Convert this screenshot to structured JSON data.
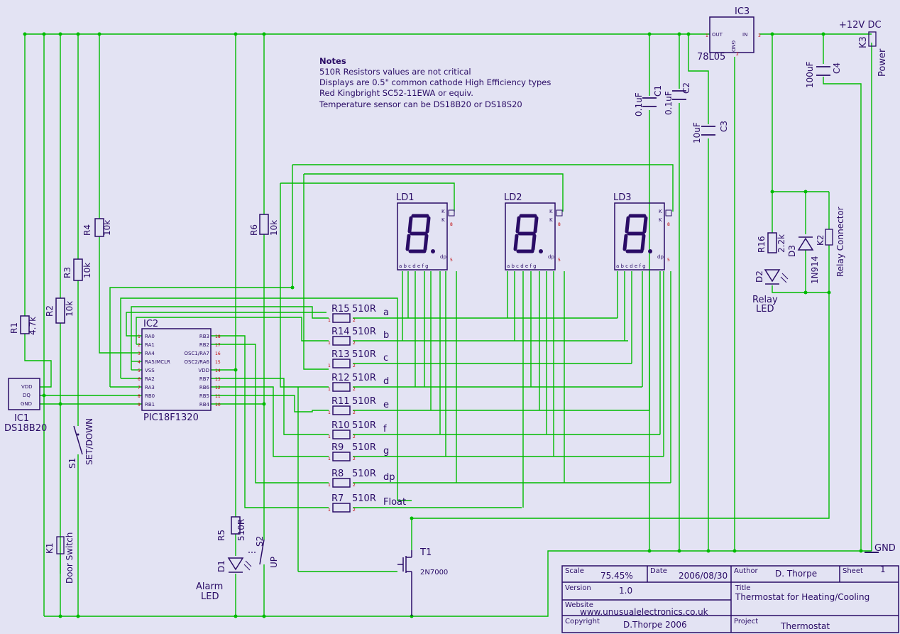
{
  "notes": {
    "heading": "Notes",
    "lines": [
      "510R Resistors values are not critical",
      "Displays are 0.5\" common cathode High Efficiency types",
      "Red Kingbright SC52-11EWA or equiv.",
      "Temperature sensor can be  DS18B20 or DS18S20"
    ]
  },
  "power": {
    "supply_label": "+12V DC",
    "gnd_label": "GND",
    "connector_ref": "K3",
    "connector_name": "Power"
  },
  "regulator": {
    "ref": "IC3",
    "part": "78L05",
    "pin_out": "OUT",
    "pin_in": "IN",
    "pin_gnd": "GND"
  },
  "capacitors": [
    {
      "ref": "C1",
      "value": "0.1uF"
    },
    {
      "ref": "C2",
      "value": "0.1uF"
    },
    {
      "ref": "C3",
      "value": "10uF"
    },
    {
      "ref": "C4",
      "value": "100uF"
    }
  ],
  "pull_resistors": [
    {
      "ref": "R1",
      "value": "4.7k"
    },
    {
      "ref": "R2",
      "value": "10k"
    },
    {
      "ref": "R3",
      "value": "10k"
    },
    {
      "ref": "R4",
      "value": "10k"
    },
    {
      "ref": "R6",
      "value": "10k"
    },
    {
      "ref": "R5",
      "value": "510R"
    },
    {
      "ref": "R16",
      "value": "2.2k"
    }
  ],
  "segment_resistors": [
    {
      "ref": "R15",
      "value": "510R",
      "net": "a"
    },
    {
      "ref": "R14",
      "value": "510R",
      "net": "b"
    },
    {
      "ref": "R13",
      "value": "510R",
      "net": "c"
    },
    {
      "ref": "R12",
      "value": "510R",
      "net": "d"
    },
    {
      "ref": "R11",
      "value": "510R",
      "net": "e"
    },
    {
      "ref": "R10",
      "value": "510R",
      "net": "f"
    },
    {
      "ref": "R9",
      "value": "510R",
      "net": "g"
    },
    {
      "ref": "R8",
      "value": "510R",
      "net": "dp"
    },
    {
      "ref": "R7",
      "value": "510R",
      "net": "Float"
    }
  ],
  "displays": [
    {
      "ref": "LD1",
      "seg_row": "a b c d e f g"
    },
    {
      "ref": "LD2",
      "seg_row": "a b c d e f g"
    },
    {
      "ref": "LD3",
      "seg_row": "a b c d e f g"
    }
  ],
  "display_pins": {
    "k": "K",
    "dp": "dp",
    "glyph": "8"
  },
  "mcu": {
    "ref": "IC2",
    "part": "PIC18F1320",
    "left_pins": [
      {
        "name": "RA0",
        "num": "1"
      },
      {
        "name": "RA1",
        "num": "2"
      },
      {
        "name": "RA4",
        "num": "3"
      },
      {
        "name": "RA5/MCLR",
        "num": "4"
      },
      {
        "name": "VSS",
        "num": "5"
      },
      {
        "name": "RA2",
        "num": "6"
      },
      {
        "name": "RA3",
        "num": "7"
      },
      {
        "name": "RB0",
        "num": "8"
      },
      {
        "name": "RB1",
        "num": "9"
      }
    ],
    "right_pins": [
      {
        "name": "RB3",
        "num": "18"
      },
      {
        "name": "RB2",
        "num": "17"
      },
      {
        "name": "OSC1/RA7",
        "num": "16"
      },
      {
        "name": "OSC2/RA6",
        "num": "15"
      },
      {
        "name": "VDD",
        "num": "14"
      },
      {
        "name": "RB7",
        "num": "13"
      },
      {
        "name": "RB6",
        "num": "12"
      },
      {
        "name": "RB5",
        "num": "11"
      },
      {
        "name": "RB4",
        "num": "10"
      }
    ]
  },
  "sensor": {
    "ref": "IC1",
    "part": "DS18B20",
    "pins": [
      "VDD",
      "DQ",
      "GND"
    ]
  },
  "switches": [
    {
      "ref": "S1",
      "name": "SET/DOWN"
    },
    {
      "ref": "S2",
      "name": "UP"
    },
    {
      "ref": "K1",
      "name": "Door Switch"
    }
  ],
  "leds": [
    {
      "ref": "D1",
      "name": "Alarm",
      "name2": "LED"
    },
    {
      "ref": "D2",
      "name": "Relay",
      "name2": "LED"
    }
  ],
  "diode": {
    "ref": "D3",
    "part": "1N914"
  },
  "relay_conn": {
    "ref": "K2",
    "name": "Relay Connector"
  },
  "transistor": {
    "ref": "T1",
    "part": "2N7000"
  },
  "title_block": {
    "scale_label": "Scale",
    "scale_value": "75.45%",
    "date_label": "Date",
    "date_value": "2006/08/30",
    "author_label": "Author",
    "author_value": "D. Thorpe",
    "sheet_label": "Sheet",
    "sheet_value": "1",
    "version_label": "Version",
    "version_value": "1.0",
    "title_label": "Title",
    "title_value": "Thermostat for Heating/Cooling",
    "website_label": "Website",
    "website_value": "www.unusualelectronics.co.uk",
    "copyright_label": "Copyright",
    "copyright_value": "D.Thorpe 2006",
    "project_label": "Project",
    "project_value": "Thermostat"
  },
  "colors": {
    "background": "#e3e3f3",
    "wire": "#00bb00",
    "body": "#2a0c66",
    "pin_number": "#c00000"
  }
}
